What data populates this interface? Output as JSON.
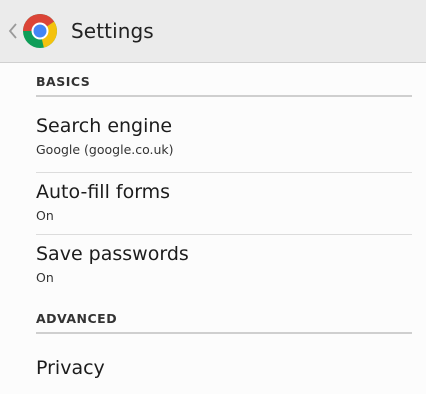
{
  "action_bar": {
    "title": "Settings"
  },
  "sections": {
    "basics": {
      "header": "BASICS"
    },
    "advanced": {
      "header": "ADVANCED"
    }
  },
  "prefs": {
    "search_engine": {
      "title": "Search engine",
      "summary": "Google (google.co.uk)"
    },
    "autofill": {
      "title": "Auto-fill forms",
      "summary": "On"
    },
    "passwords": {
      "title": "Save passwords",
      "summary": "On"
    },
    "privacy": {
      "title": "Privacy"
    }
  },
  "colors": {
    "action_bar_bg": "#ebebeb",
    "chrome_red": "#db4437",
    "chrome_yellow": "#f4c20d",
    "chrome_green": "#0f9d58",
    "chrome_blue": "#4285f4"
  },
  "icons": {
    "back": "back-caret-icon",
    "logo": "chrome-logo-icon"
  }
}
